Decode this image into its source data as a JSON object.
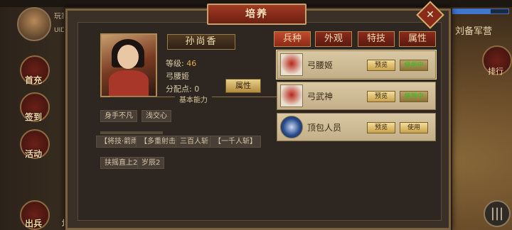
{
  "hud": {
    "uid_text": "玩家",
    "uid_label": "UID",
    "right_title": "刘备军营",
    "rank_label": "排行",
    "menu_glyph": "|||",
    "side_buttons": [
      {
        "label": "首充"
      },
      {
        "label": "签到"
      },
      {
        "label": "活动"
      },
      {
        "label": "出兵"
      },
      {
        "label": "培养"
      }
    ]
  },
  "dialog": {
    "title": "培养",
    "close_glyph": "✕",
    "general": {
      "name": "孙尚香",
      "level_label": "等级:",
      "level_value": "46",
      "unit_type": "弓腰姬",
      "points_label": "分配点:",
      "points_value": "0",
      "attr_button": "属性",
      "section_header": "基本能力",
      "traits": [
        "身手不凡",
        "浅交心"
      ],
      "skills": [
        "【将技·箭雨】",
        "【多重射击】",
        "三百人斩",
        "【一千人斩】"
      ],
      "extras": [
        "扶摇直上2",
        "岁辰2"
      ]
    },
    "tabs": [
      {
        "label": "兵种",
        "active": true
      },
      {
        "label": "外观",
        "active": false
      },
      {
        "label": "特技",
        "active": false
      },
      {
        "label": "属性",
        "active": false
      }
    ],
    "units": [
      {
        "name": "弓腰姬",
        "preview": "预览",
        "use": "使用中",
        "in_use": true,
        "icon": "archer-maiden-icon"
      },
      {
        "name": "弓武神",
        "preview": "预览",
        "use": "使用中",
        "in_use": true,
        "icon": "archer-god-icon"
      },
      {
        "name": "顶包人员",
        "preview": "预览",
        "use": "使用",
        "in_use": false,
        "icon": "blue-orb-icon"
      }
    ]
  }
}
